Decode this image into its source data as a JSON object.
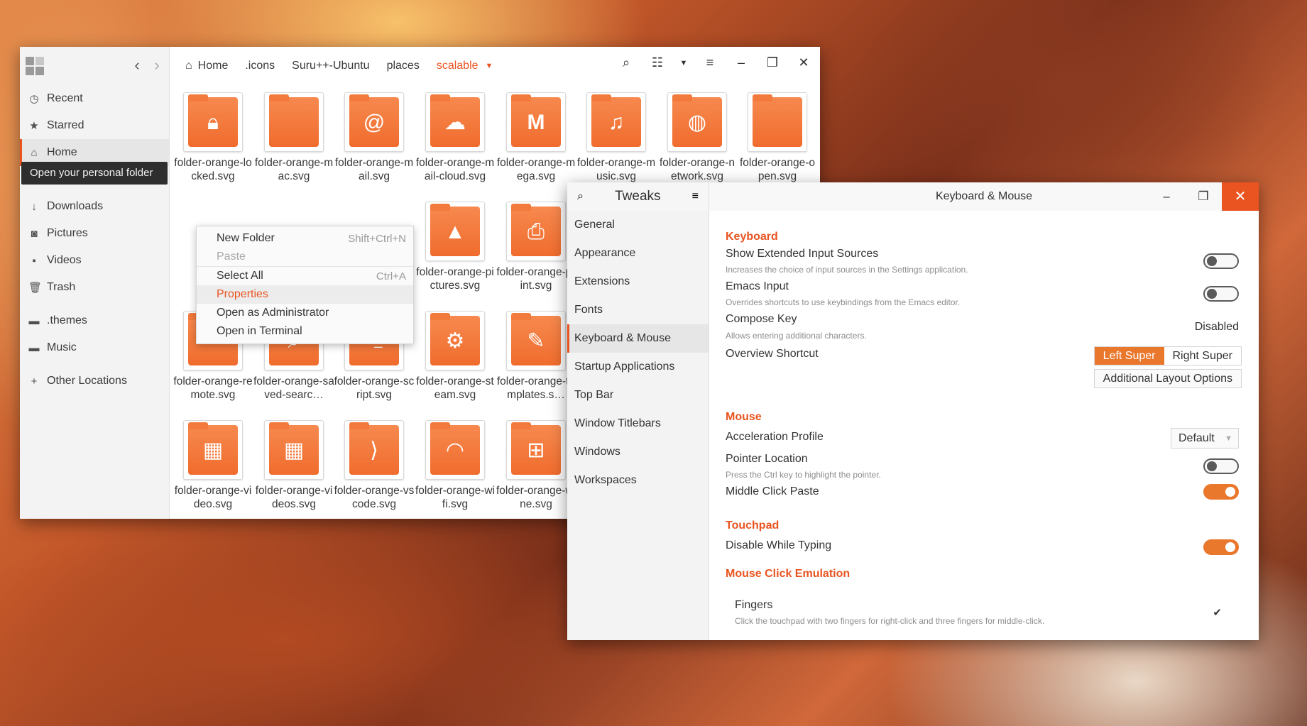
{
  "files": {
    "sidebar": {
      "items": [
        {
          "label": "Recent",
          "icon": "clock-icon"
        },
        {
          "label": "Starred",
          "icon": "star-icon"
        },
        {
          "label": "Home",
          "icon": "home-icon"
        },
        {
          "label": "Downloads",
          "icon": "download-icon"
        },
        {
          "label": "Pictures",
          "icon": "camera-icon"
        },
        {
          "label": "Videos",
          "icon": "video-icon"
        },
        {
          "label": "Trash",
          "icon": "trash-icon"
        },
        {
          "label": ".themes",
          "icon": "folder-icon"
        },
        {
          "label": "Music",
          "icon": "folder-icon"
        },
        {
          "label": "Other Locations",
          "icon": "plus-icon"
        }
      ],
      "tooltip": "Open your personal folder"
    },
    "breadcrumbs": [
      "Home",
      ".icons",
      "Suru++-Ubuntu",
      "places",
      "scalable"
    ],
    "files": [
      {
        "name": "folder-orange-locked.svg"
      },
      {
        "name": "folder-orange-mac.svg"
      },
      {
        "name": "folder-orange-mail.svg"
      },
      {
        "name": "folder-orange-mail-cloud.svg"
      },
      {
        "name": "folder-orange-mega.svg"
      },
      {
        "name": "folder-orange-music.svg"
      },
      {
        "name": "folder-orange-network.svg"
      },
      {
        "name": "folder-orange-open.svg"
      },
      {
        "name": "folder-orange-pictures.svg"
      },
      {
        "name": "folder-orange-print.svg"
      },
      {
        "name": "folder-orange-remote.svg"
      },
      {
        "name": "folder-orange-saved-searc…"
      },
      {
        "name": "folder-orange-script.svg"
      },
      {
        "name": "folder-orange-steam.svg"
      },
      {
        "name": "folder-orange-templates.s…"
      },
      {
        "name": "folder-orange-video.svg"
      },
      {
        "name": "folder-orange-videos.svg"
      },
      {
        "name": "folder-orange-vscode.svg"
      },
      {
        "name": "folder-orange-wifi.svg"
      },
      {
        "name": "folder-orange-wine.svg"
      }
    ],
    "context_menu": [
      {
        "label": "New Folder",
        "accel": "Shift+Ctrl+N"
      },
      {
        "label": "Paste",
        "accel": ""
      },
      {
        "label": "Select All",
        "accel": "Ctrl+A"
      },
      {
        "label": "Properties",
        "accel": ""
      },
      {
        "label": "Open as Administrator",
        "accel": ""
      },
      {
        "label": "Open in Terminal",
        "accel": ""
      }
    ]
  },
  "tweaks": {
    "app_title": "Tweaks",
    "page_title": "Keyboard & Mouse",
    "sidebar": [
      "General",
      "Appearance",
      "Extensions",
      "Fonts",
      "Keyboard & Mouse",
      "Startup Applications",
      "Top Bar",
      "Window Titlebars",
      "Windows",
      "Workspaces"
    ],
    "keyboard": {
      "heading": "Keyboard",
      "ext_sources": {
        "label": "Show Extended Input Sources",
        "desc": "Increases the choice of input sources in the Settings application.",
        "enabled": false
      },
      "emacs": {
        "label": "Emacs Input",
        "desc": "Overrides shortcuts to use keybindings from the Emacs editor.",
        "enabled": false
      },
      "compose": {
        "label": "Compose Key",
        "desc": "Allows entering additional characters.",
        "value": "Disabled"
      },
      "overview": {
        "label": "Overview Shortcut",
        "left": "Left Super",
        "right": "Right Super",
        "selected": "Left Super"
      },
      "layout_button": "Additional Layout Options"
    },
    "mouse": {
      "heading": "Mouse",
      "accel": {
        "label": "Acceleration Profile",
        "value": "Default"
      },
      "pointer": {
        "label": "Pointer Location",
        "desc": "Press the Ctrl key to highlight the pointer.",
        "enabled": false
      },
      "middle_paste": {
        "label": "Middle Click Paste",
        "enabled": true
      }
    },
    "touchpad": {
      "heading": "Touchpad",
      "dwt": {
        "label": "Disable While Typing",
        "enabled": true
      }
    },
    "emulation": {
      "heading": "Mouse Click Emulation",
      "fingers": {
        "label": "Fingers",
        "desc": "Click the touchpad with two fingers for right-click and three fingers for middle-click.",
        "checked": true
      }
    }
  }
}
